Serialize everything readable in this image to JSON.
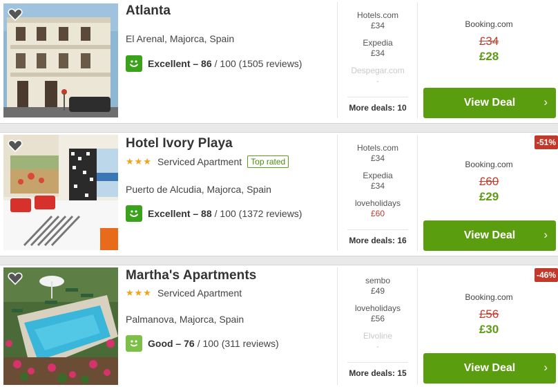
{
  "listings": [
    {
      "name": "Atlanta",
      "stars": "",
      "type": "",
      "badge": "",
      "location": "El Arenal, Majorca, Spain",
      "rating_label": "Excellent – 86",
      "rating_rest": " / 100 (1505 reviews)",
      "rating_color": "#3aa21b",
      "deals": [
        {
          "site": "Hotels.com",
          "price": "£34"
        },
        {
          "site": "Expedia",
          "price": "£34"
        },
        {
          "site": "Despegar.com",
          "price": "-"
        }
      ],
      "more_deals": "More deals: 10",
      "provider": "Booking.com",
      "old_price": "£34",
      "new_price": "£28",
      "discount": "",
      "cta": "View Deal"
    },
    {
      "name": "Hotel Ivory Playa",
      "stars": "★★★",
      "type": "Serviced Apartment",
      "badge": "Top rated",
      "location": "Puerto de Alcudia, Majorca, Spain",
      "rating_label": "Excellent – 88",
      "rating_rest": " / 100 (1372 reviews)",
      "rating_color": "#3aa21b",
      "deals": [
        {
          "site": "Hotels.com",
          "price": "£34"
        },
        {
          "site": "Expedia",
          "price": "£34"
        },
        {
          "site": "loveholidays",
          "price": "£60"
        }
      ],
      "more_deals": "More deals: 16",
      "provider": "Booking.com",
      "old_price": "£60",
      "new_price": "£29",
      "discount": "-51%",
      "cta": "View Deal"
    },
    {
      "name": "Martha's Apartments",
      "stars": "★★★",
      "type": "Serviced Apartment",
      "badge": "",
      "location": "Palmanova, Majorca, Spain",
      "rating_label": "Good – 76",
      "rating_rest": " / 100 (311 reviews)",
      "rating_color": "#7cc04a",
      "deals": [
        {
          "site": "sembo",
          "price": "£49"
        },
        {
          "site": "loveholidays",
          "price": "£56"
        },
        {
          "site": "Elvoline",
          "price": "-"
        }
      ],
      "more_deals": "More deals: 15",
      "provider": "Booking.com",
      "old_price": "£56",
      "new_price": "£30",
      "discount": "-46%",
      "cta": "View Deal"
    }
  ],
  "colors": {
    "cta_green": "#5a9e0f",
    "new_price_green": "#5a9c12",
    "old_price_red": "#c0392b",
    "star_orange": "#f0a31b"
  }
}
